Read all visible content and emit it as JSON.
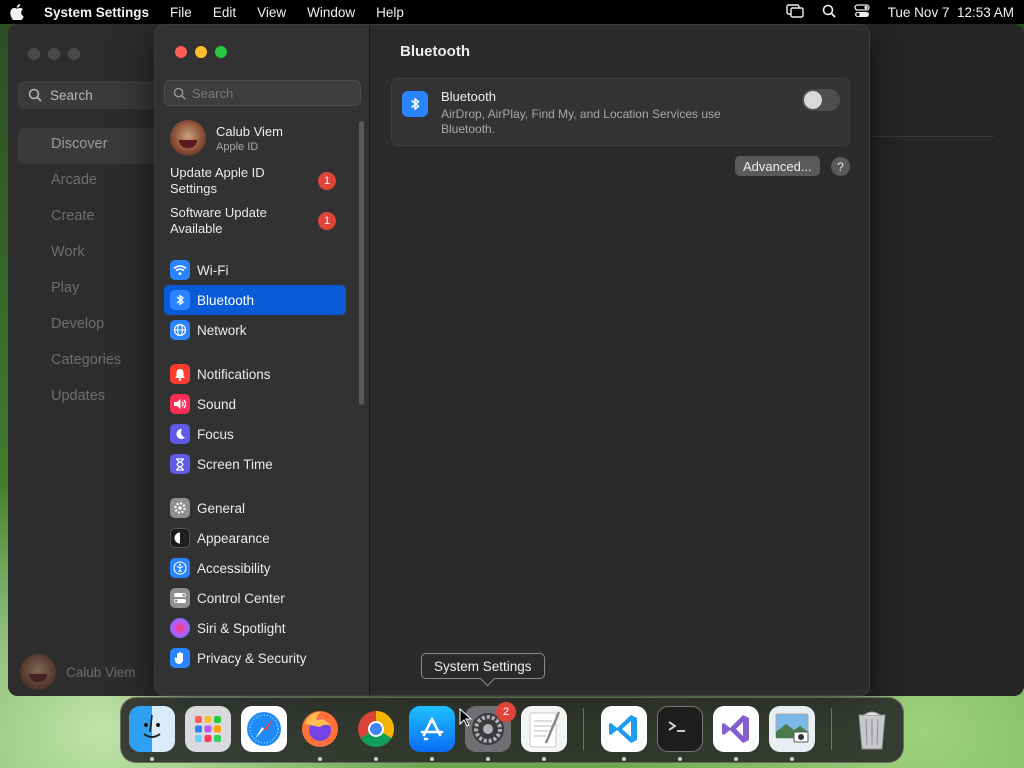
{
  "menubar": {
    "app_name": "System Settings",
    "menus": [
      "File",
      "Edit",
      "View",
      "Window",
      "Help"
    ],
    "clock": "Tue Nov 7  12:53 AM",
    "status_icons": [
      "screen-mirroring-icon",
      "spotlight-search-icon",
      "control-center-icon"
    ]
  },
  "background_app": {
    "search_label": "Search",
    "nav": [
      "Discover",
      "Arcade",
      "Create",
      "Work",
      "Play",
      "Develop",
      "Categories",
      "Updates"
    ],
    "active_nav": "Discover",
    "user_name": "Calub Viem"
  },
  "settings": {
    "search_placeholder": "Search",
    "profile": {
      "name": "Calub Viem",
      "subtitle": "Apple ID"
    },
    "notices": [
      {
        "label_line1": "Update Apple ID",
        "label_line2": "Settings",
        "badge": "1"
      },
      {
        "label_line1": "Software Update",
        "label_line2": "Available",
        "badge": "1"
      }
    ],
    "group1": [
      {
        "label": "Wi-Fi",
        "icon": "wifi-icon",
        "color": "#2a83ff"
      },
      {
        "label": "Bluetooth",
        "icon": "bluetooth-icon",
        "color": "#2a83ff"
      },
      {
        "label": "Network",
        "icon": "globe-icon",
        "color": "#2a83ff"
      }
    ],
    "group2": [
      {
        "label": "Notifications",
        "icon": "bell-icon",
        "color": "#ff3b30"
      },
      {
        "label": "Sound",
        "icon": "speaker-icon",
        "color": "#ff2d55"
      },
      {
        "label": "Focus",
        "icon": "moon-icon",
        "color": "#5e5ce6"
      },
      {
        "label": "Screen Time",
        "icon": "hourglass-icon",
        "color": "#5e5ce6"
      }
    ],
    "group3": [
      {
        "label": "General",
        "icon": "gear-icon",
        "color": "#8e8e93"
      },
      {
        "label": "Appearance",
        "icon": "appearance-icon",
        "color": "#1c1c1e"
      },
      {
        "label": "Accessibility",
        "icon": "accessibility-icon",
        "color": "#2a83ff"
      },
      {
        "label": "Control Center",
        "icon": "switches-icon",
        "color": "#8e8e93"
      },
      {
        "label": "Siri & Spotlight",
        "icon": "siri-icon",
        "color": "#bf5af2"
      },
      {
        "label": "Privacy & Security",
        "icon": "hand-icon",
        "color": "#2a83ff"
      }
    ],
    "active_item": "Bluetooth",
    "content": {
      "title": "Bluetooth",
      "bluetooth_row": {
        "title": "Bluetooth",
        "description": "AirDrop, AirPlay, Find My, and Location Services use Bluetooth.",
        "toggle_on": false
      },
      "advanced_label": "Advanced...",
      "help_label": "?"
    }
  },
  "tooltip": "System Settings",
  "dock": {
    "apps": [
      {
        "name": "Finder",
        "icon": "finder-icon",
        "running": true
      },
      {
        "name": "Launchpad",
        "icon": "launchpad-icon",
        "running": false
      },
      {
        "name": "Safari",
        "icon": "safari-icon",
        "running": false
      },
      {
        "name": "Firefox",
        "icon": "firefox-icon",
        "running": true
      },
      {
        "name": "Google Chrome",
        "icon": "chrome-icon",
        "running": true
      },
      {
        "name": "App Store",
        "icon": "app-store-icon",
        "running": true
      },
      {
        "name": "System Settings",
        "icon": "system-settings-icon",
        "running": true,
        "badge": "2"
      },
      {
        "name": "TextEdit",
        "icon": "textedit-icon",
        "running": true
      },
      {
        "name": "Visual Studio Code",
        "icon": "vscode-icon",
        "running": true
      },
      {
        "name": "Terminal",
        "icon": "terminal-icon",
        "running": true
      },
      {
        "name": "Visual Studio",
        "icon": "visual-studio-icon",
        "running": true
      },
      {
        "name": "Preview",
        "icon": "preview-icon",
        "running": true
      },
      {
        "name": "Trash",
        "icon": "trash-icon",
        "running": false
      }
    ]
  }
}
